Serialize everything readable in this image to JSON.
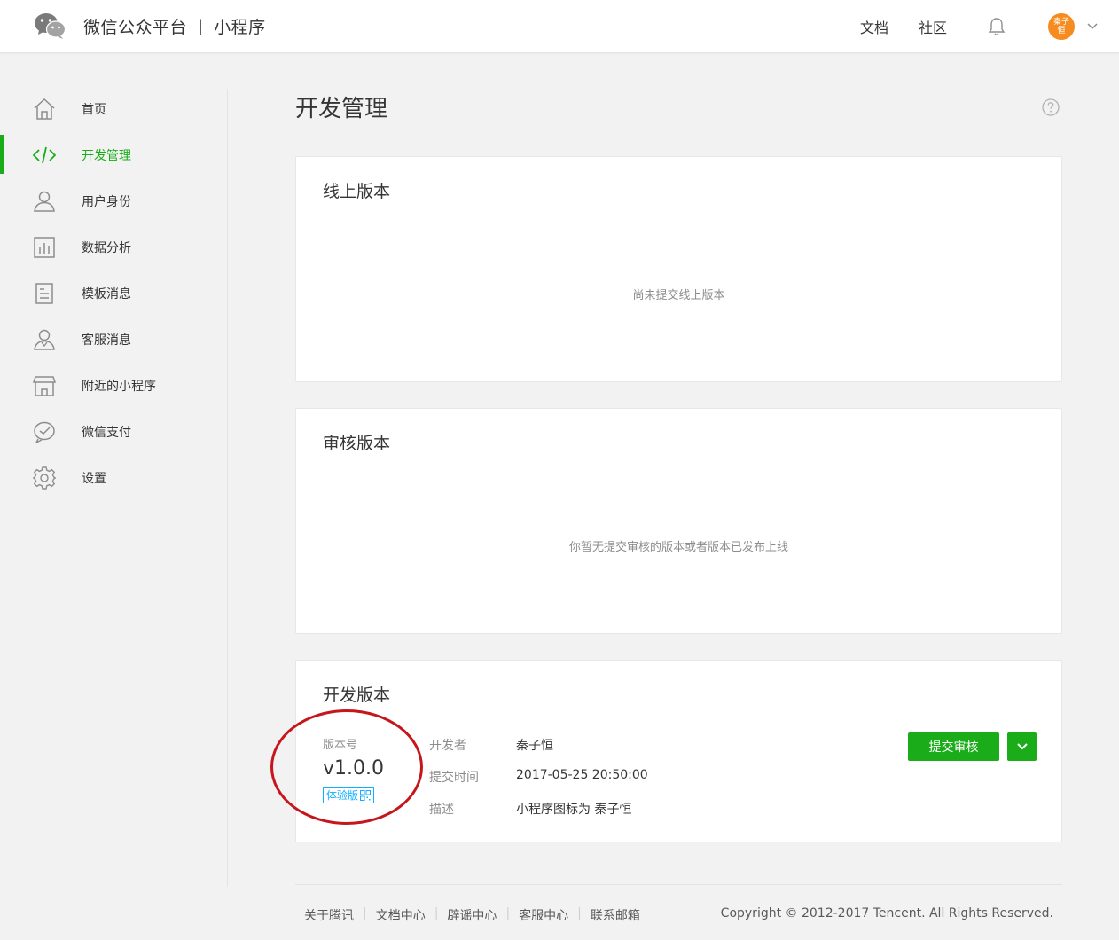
{
  "header": {
    "brand": "微信公众平台",
    "separator": "|",
    "product": "小程序",
    "links": [
      "文档",
      "社区"
    ],
    "avatar_text": "秦子恒"
  },
  "sidebar": {
    "items": [
      {
        "label": "首页",
        "icon": "home-icon"
      },
      {
        "label": "开发管理",
        "icon": "code-icon",
        "active": true
      },
      {
        "label": "用户身份",
        "icon": "user-icon"
      },
      {
        "label": "数据分析",
        "icon": "chart-icon"
      },
      {
        "label": "模板消息",
        "icon": "doc-icon"
      },
      {
        "label": "客服消息",
        "icon": "service-icon"
      },
      {
        "label": "附近的小程序",
        "icon": "store-icon"
      },
      {
        "label": "微信支付",
        "icon": "pay-icon"
      },
      {
        "label": "设置",
        "icon": "gear-icon"
      }
    ]
  },
  "main": {
    "title": "开发管理",
    "online": {
      "title": "线上版本",
      "empty": "尚未提交线上版本"
    },
    "review": {
      "title": "审核版本",
      "empty": "你暂无提交审核的版本或者版本已发布上线"
    },
    "dev": {
      "title": "开发版本",
      "version_label": "版本号",
      "version": "v1.0.0",
      "badge": "体验版",
      "developer_key": "开发者",
      "developer": "秦子恒",
      "time_key": "提交时间",
      "time": "2017-05-25 20:50:00",
      "desc_key": "描述",
      "desc": "小程序图标为 秦子恒",
      "submit": "提交审核"
    }
  },
  "footer": {
    "links": [
      "关于腾讯",
      "文档中心",
      "辟谣中心",
      "客服中心",
      "联系邮箱"
    ],
    "separator": "|",
    "copyright": "Copyright © 2012-2017 Tencent. All Rights Reserved."
  },
  "colors": {
    "accent": "#1aad19",
    "annotation": "#c5171b",
    "badge": "#10aeff"
  }
}
